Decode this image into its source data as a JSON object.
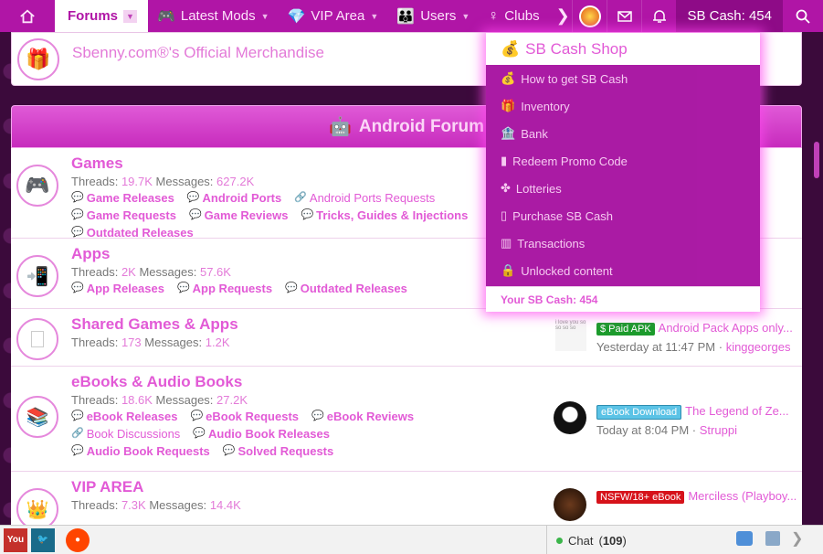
{
  "nav": {
    "tabs": [
      {
        "label": "Forums",
        "active": true
      },
      {
        "label": "Latest Mods",
        "icon": "gamepad-icon"
      },
      {
        "label": "VIP Area",
        "icon": "diamond-icon"
      },
      {
        "label": "Users",
        "icon": "users-icon"
      },
      {
        "label": "Clubs",
        "icon": "clubs-icon"
      }
    ],
    "cash_label": "SB Cash: 454"
  },
  "merch": {
    "title": "Sbenny.com®'s Official Merchandise"
  },
  "section_title": "Android Forum",
  "forums": [
    {
      "title": "Games",
      "threads": "19.7K",
      "messages": "627.2K",
      "subs": [
        {
          "label": "Game Releases",
          "bold": true
        },
        {
          "label": "Android Ports",
          "bold": true
        },
        {
          "label": "Android Ports Requests",
          "bold": false,
          "link": true
        },
        {
          "label": "Game Requests",
          "bold": true
        },
        {
          "label": "Game Reviews",
          "bold": true
        },
        {
          "label": "Tricks, Guides & Injections",
          "bold": true
        },
        {
          "label": "Outdated Releases",
          "bold": true
        }
      ]
    },
    {
      "title": "Apps",
      "threads": "2K",
      "messages": "57.6K",
      "subs": [
        {
          "label": "App Releases",
          "bold": true
        },
        {
          "label": "App Requests",
          "bold": true
        },
        {
          "label": "Outdated Releases",
          "bold": true
        }
      ]
    },
    {
      "title": "Shared Games & Apps",
      "threads": "173",
      "messages": "1.2K",
      "subs": [],
      "last": {
        "prefix": "$ Paid APK",
        "thread": "Android Pack Apps only...",
        "meta": "Yesterday at 11:47 PM",
        "user": "kinggeorges"
      }
    },
    {
      "title": "eBooks & Audio Books",
      "threads": "18.6K",
      "messages": "27.2K",
      "subs": [
        {
          "label": "eBook Releases",
          "bold": true
        },
        {
          "label": "eBook Requests",
          "bold": true
        },
        {
          "label": "eBook Reviews",
          "bold": true
        },
        {
          "label": "Book Discussions",
          "bold": false,
          "link": true
        },
        {
          "label": "Audio Book Releases",
          "bold": true
        },
        {
          "label": "Audio Book Requests",
          "bold": true
        },
        {
          "label": "Solved Requests",
          "bold": true
        }
      ],
      "last": {
        "prefix": "eBook Download",
        "thread": "The Legend of Ze...",
        "meta": "Today at 8:04 PM",
        "user": "Struppi"
      }
    },
    {
      "title": "VIP AREA",
      "threads": "7.3K",
      "messages": "14.4K",
      "subs": [],
      "last": {
        "prefix": "NSFW/18+ eBook",
        "thread": "Merciless (Playboy...",
        "meta": "",
        "user": ""
      }
    }
  ],
  "labels": {
    "threads": "Threads:",
    "messages": "Messages:",
    "separator": "·"
  },
  "dropdown": {
    "title": "SB Cash Shop",
    "items": [
      {
        "label": "How to get SB Cash",
        "icon": "moneybag-icon"
      },
      {
        "label": "Inventory",
        "icon": "gift-icon"
      },
      {
        "label": "Bank",
        "icon": "bank-icon"
      },
      {
        "label": "Redeem Promo Code",
        "icon": "code-icon"
      },
      {
        "label": "Lotteries",
        "icon": "clover-icon"
      },
      {
        "label": "Purchase SB Cash",
        "icon": "cart-icon"
      },
      {
        "label": "Transactions",
        "icon": "chart-icon"
      },
      {
        "label": "Unlocked content",
        "icon": "lock-icon"
      }
    ],
    "footer": "Your SB Cash: 454"
  },
  "bottombar": {
    "chat_label": "Chat",
    "chat_count": "109"
  }
}
